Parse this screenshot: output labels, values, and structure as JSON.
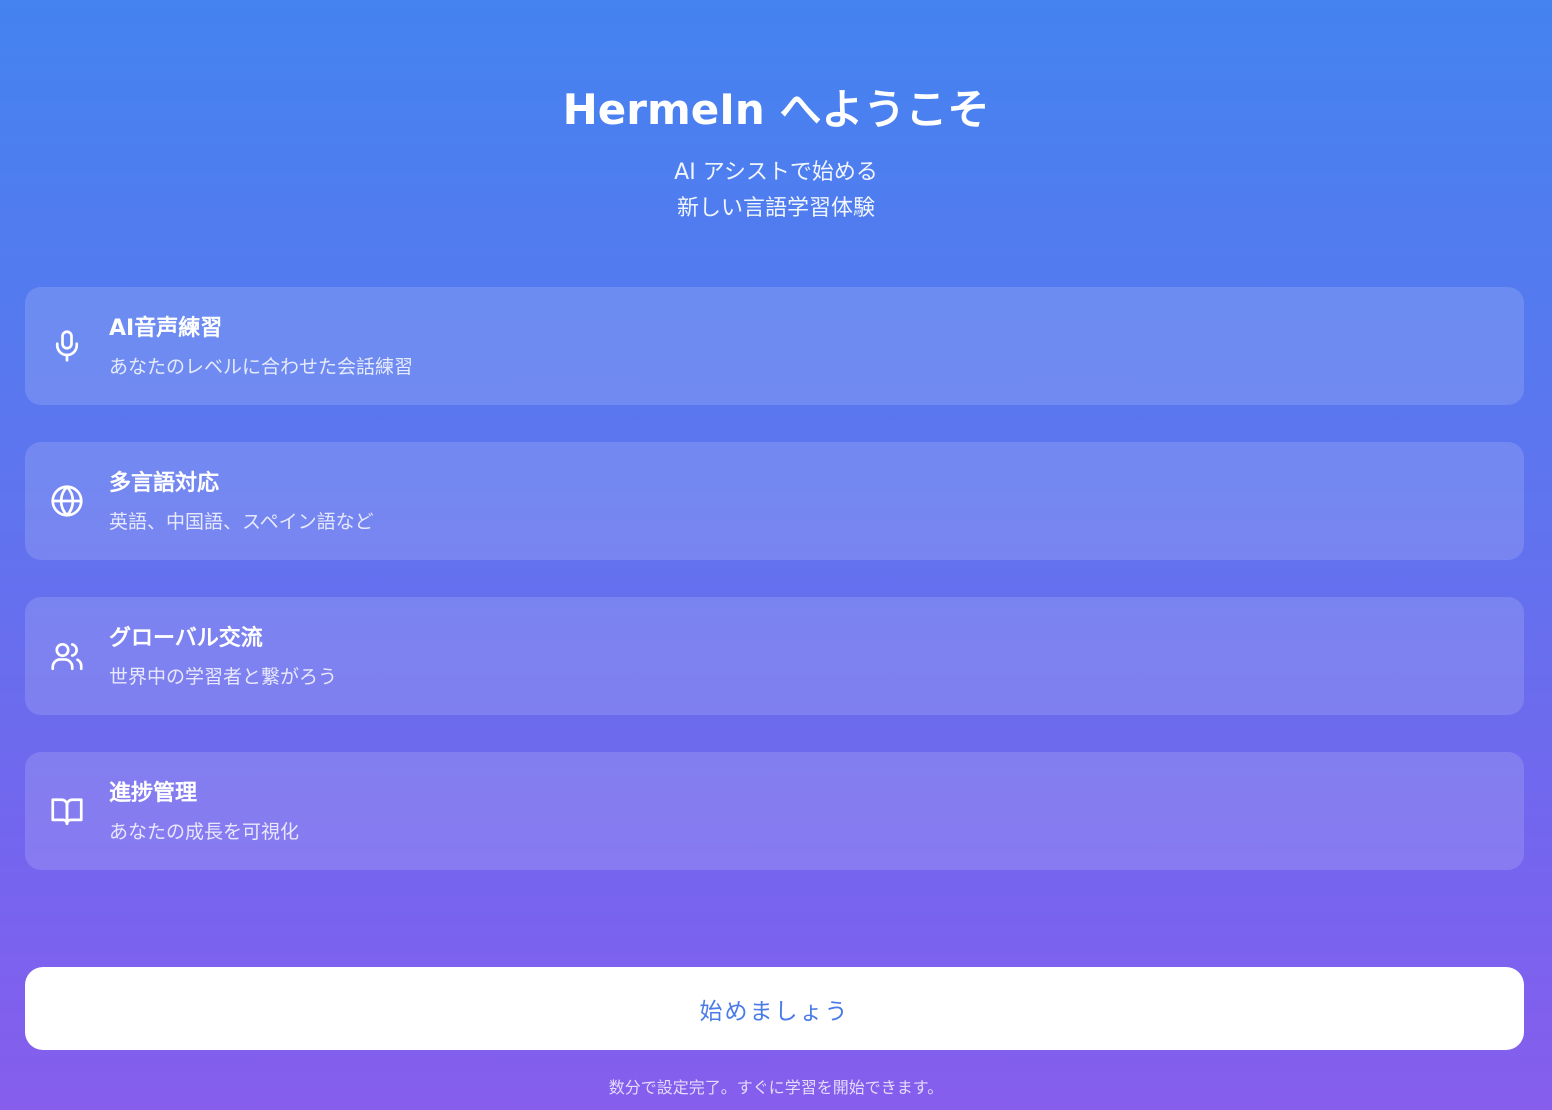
{
  "header": {
    "title": "HermeIn へようこそ",
    "subtitle_line1": "AI アシストで始める",
    "subtitle_line2": "新しい言語学習体験"
  },
  "features": [
    {
      "icon": "microphone-icon",
      "title": "AI音声練習",
      "description": "あなたのレベルに合わせた会話練習"
    },
    {
      "icon": "globe-icon",
      "title": "多言語対応",
      "description": "英語、中国語、スペイン語など"
    },
    {
      "icon": "users-icon",
      "title": "グローバル交流",
      "description": "世界中の学習者と繋がろう"
    },
    {
      "icon": "book-icon",
      "title": "進捗管理",
      "description": "あなたの成長を可視化"
    }
  ],
  "cta": {
    "label": "始めましょう",
    "note": "数分で設定完了。すぐに学習を開始できます。"
  },
  "colors": {
    "gradient_top": "#4483f0",
    "gradient_bottom": "#865ded",
    "button_text": "#4a7be8"
  }
}
